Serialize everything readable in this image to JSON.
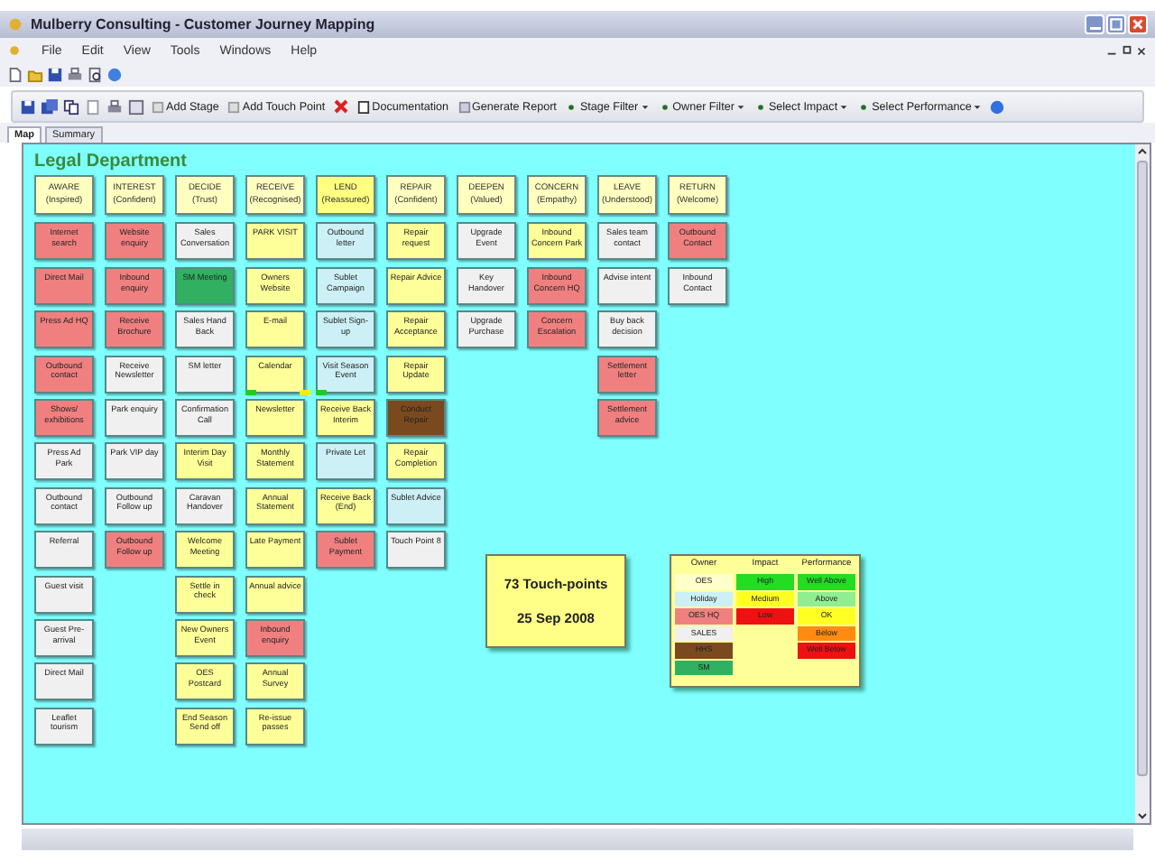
{
  "window": {
    "title": "Mulberry Consulting - Customer Journey Mapping"
  },
  "menu": [
    "File",
    "Edit",
    "View",
    "Tools",
    "Windows",
    "Help"
  ],
  "toolbar": {
    "buttons": [
      "Add Stage",
      "Add Touch Point",
      "Documentation",
      "Generate Report"
    ],
    "filters": [
      "Stage Filter",
      "Owner Filter",
      "Select Impact",
      "Select Performance"
    ]
  },
  "tabs": [
    {
      "label": "Map",
      "selected": true
    },
    {
      "label": "Summary",
      "selected": false
    }
  ],
  "department": "Legal Department",
  "stages": [
    {
      "title": "AWARE",
      "subtitle": "(Inspired)",
      "color": "#ffffc0",
      "cards": [
        {
          "label": "Internet search",
          "color": "#f08080"
        },
        {
          "label": "Direct Mail",
          "color": "#f08080"
        },
        {
          "label": "Press Ad HQ",
          "color": "#f08080"
        },
        {
          "label": "Outbound contact",
          "color": "#f08080"
        },
        {
          "label": "Shows/ exhibitions",
          "color": "#f08080"
        },
        {
          "label": "Press Ad Park",
          "color": "#f0f0f0"
        },
        {
          "label": "Outbound contact",
          "color": "#f0f0f0"
        },
        {
          "label": "Referral",
          "color": "#f0f0f0"
        },
        {
          "label": "Guest visit",
          "color": "#f0f0f0"
        },
        {
          "label": "Guest Pre-arrival",
          "color": "#f0f0f0"
        },
        {
          "label": "Direct Mail",
          "color": "#f0f0f0"
        },
        {
          "label": "Leaflet tourism",
          "color": "#f0f0f0"
        }
      ]
    },
    {
      "title": "INTEREST",
      "subtitle": "(Confident)",
      "color": "#ffffc0",
      "cards": [
        {
          "label": "Website enquiry",
          "color": "#f08080"
        },
        {
          "label": "Inbound enquiry",
          "color": "#f08080"
        },
        {
          "label": "Receive Brochure",
          "color": "#f08080"
        },
        {
          "label": "Receive Newsletter",
          "color": "#f0f0f0"
        },
        {
          "label": "Park enquiry",
          "color": "#f0f0f0"
        },
        {
          "label": "Park VIP day",
          "color": "#f0f0f0"
        },
        {
          "label": "Outbound Follow up",
          "color": "#f0f0f0"
        },
        {
          "label": "Outbound Follow up",
          "color": "#f08080"
        }
      ]
    },
    {
      "title": "DECIDE",
      "subtitle": "(Trust)",
      "color": "#ffffc0",
      "cards": [
        {
          "label": "Sales Conversation",
          "color": "#f0f0f0"
        },
        {
          "label": "SM Meeting",
          "color": "#30b060"
        },
        {
          "label": "Sales Hand Back",
          "color": "#f0f0f0"
        },
        {
          "label": "SM letter",
          "color": "#f0f0f0"
        },
        {
          "label": "Confirmation Call",
          "color": "#f0f0f0"
        },
        {
          "label": "Interim Day Visit",
          "color": "#ffff99"
        },
        {
          "label": "Caravan Handover",
          "color": "#f0f0f0"
        },
        {
          "label": "Welcome Meeting",
          "color": "#ffff99"
        },
        {
          "label": "Settle in check",
          "color": "#ffff99"
        },
        {
          "label": "New Owners Event",
          "color": "#ffff99"
        },
        {
          "label": "OES Postcard",
          "color": "#ffff99"
        },
        {
          "label": "End Season Send off",
          "color": "#ffff99"
        }
      ]
    },
    {
      "title": "RECEIVE",
      "subtitle": "(Recognised)",
      "color": "#ffffc0",
      "cards": [
        {
          "label": "PARK VISIT",
          "color": "#ffff99"
        },
        {
          "label": "Owners Website",
          "color": "#ffff99"
        },
        {
          "label": "E-mail",
          "color": "#ffff99"
        },
        {
          "label": "Calendar",
          "color": "#ffff99",
          "markers": [
            {
              "color": "#22cc22"
            },
            {
              "color": "#ffee00"
            }
          ]
        },
        {
          "label": "Newsletter",
          "color": "#ffff99"
        },
        {
          "label": "Monthly Statement",
          "color": "#ffff99"
        },
        {
          "label": "Annual Statement",
          "color": "#ffff99"
        },
        {
          "label": "Late Payment",
          "color": "#ffff99"
        },
        {
          "label": "Annual advice",
          "color": "#ffff99"
        },
        {
          "label": "Inbound enquiry",
          "color": "#f08080"
        },
        {
          "label": "Annual Survey",
          "color": "#ffff99"
        },
        {
          "label": "Re-issue passes",
          "color": "#ffff99"
        }
      ]
    },
    {
      "title": "LEND",
      "subtitle": "(Reassured)",
      "color": "#ffff80",
      "cards": [
        {
          "label": "Outbound letter",
          "color": "#cdf0f6"
        },
        {
          "label": "Sublet Campaign",
          "color": "#cdf0f6"
        },
        {
          "label": "Sublet Sign-up",
          "color": "#cdf0f6"
        },
        {
          "label": "Visit Season Event",
          "color": "#cdf0f6",
          "markers": [
            {
              "color": "#22cc22"
            }
          ]
        },
        {
          "label": "Receive Back Interim",
          "color": "#ffff99"
        },
        {
          "label": "Private Let",
          "color": "#cdf0f6"
        },
        {
          "label": "Receive Back (End)",
          "color": "#ffff99"
        },
        {
          "label": "Sublet Payment",
          "color": "#f08080"
        }
      ]
    },
    {
      "title": "REPAIR",
      "subtitle": "(Confident)",
      "color": "#ffffc0",
      "cards": [
        {
          "label": "Repair request",
          "color": "#ffff99"
        },
        {
          "label": "Repair Advice",
          "color": "#ffff99"
        },
        {
          "label": "Repair Acceptance",
          "color": "#ffff99"
        },
        {
          "label": "Repair Update",
          "color": "#ffff99"
        },
        {
          "label": "Conduct Repair",
          "color": "#7a4a1e"
        },
        {
          "label": "Repair Completion",
          "color": "#ffff99"
        },
        {
          "label": "Sublet Advice",
          "color": "#cdf0f6"
        },
        {
          "label": "Touch Point 8",
          "color": "#f0f0f0"
        }
      ]
    },
    {
      "title": "DEEPEN",
      "subtitle": "(Valued)",
      "color": "#ffffc0",
      "cards": [
        {
          "label": "Upgrade Event",
          "color": "#f0f0f0"
        },
        {
          "label": "Key Handover",
          "color": "#f0f0f0"
        },
        {
          "label": "Upgrade Purchase",
          "color": "#f0f0f0"
        }
      ]
    },
    {
      "title": "CONCERN",
      "subtitle": "(Empathy)",
      "color": "#ffffc0",
      "cards": [
        {
          "label": "Inbound Concern Park",
          "color": "#ffff99"
        },
        {
          "label": "Inbound Concern HQ",
          "color": "#f08080"
        },
        {
          "label": "Concern Escalation",
          "color": "#f08080"
        }
      ]
    },
    {
      "title": "LEAVE",
      "subtitle": "(Understood)",
      "color": "#ffffc0",
      "cards": [
        {
          "label": "Sales team contact",
          "color": "#f0f0f0"
        },
        {
          "label": "Advise intent",
          "color": "#f0f0f0"
        },
        {
          "label": "Buy back decision",
          "color": "#f0f0f0"
        },
        {
          "label": "Settlement letter",
          "color": "#f08080"
        },
        {
          "label": "Settlement advice",
          "color": "#f08080"
        }
      ]
    },
    {
      "title": "RETURN",
      "subtitle": "(Welcome)",
      "color": "#ffffc0",
      "cards": [
        {
          "label": "Outbound Contact",
          "color": "#f08080"
        },
        {
          "label": "Inbound Contact",
          "color": "#f0f0f0"
        }
      ]
    }
  ],
  "summary": {
    "count": "73 Touch-points",
    "date": "25 Sep 2008"
  },
  "legend": {
    "columns": [
      {
        "header": "Owner",
        "items": [
          {
            "label": "OES",
            "color": "#ffffcc"
          },
          {
            "label": "Holiday",
            "color": "#cdf0f6"
          },
          {
            "label": "OES HQ",
            "color": "#f08080"
          },
          {
            "label": "SALES",
            "color": "#f0f0f0"
          },
          {
            "label": "HHS",
            "color": "#7a4a1e"
          },
          {
            "label": "SM",
            "color": "#30b060"
          }
        ]
      },
      {
        "header": "Impact",
        "items": [
          {
            "label": "High",
            "color": "#22dd22"
          },
          {
            "label": "Medium",
            "color": "#ffff22"
          },
          {
            "label": "Low",
            "color": "#ee1111"
          }
        ]
      },
      {
        "header": "Performance",
        "items": [
          {
            "label": "Well Above",
            "color": "#22dd22"
          },
          {
            "label": "Above",
            "color": "#90ee90"
          },
          {
            "label": "OK",
            "color": "#ffff22"
          },
          {
            "label": "Below",
            "color": "#ff8c10"
          },
          {
            "label": "Well Below",
            "color": "#ee1111"
          }
        ]
      }
    ]
  }
}
